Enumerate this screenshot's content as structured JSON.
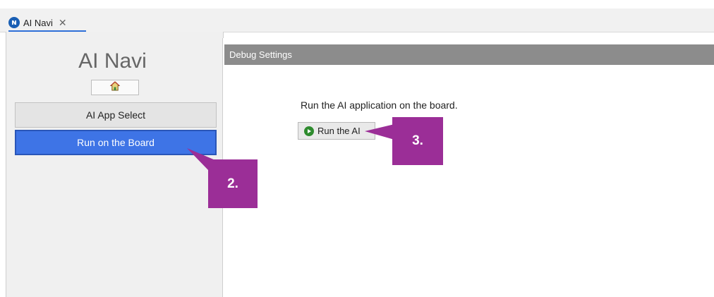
{
  "tab": {
    "label": "AI Navi",
    "close_glyph": "✕",
    "icon": "renesas-logo-icon"
  },
  "sidebar": {
    "title": "AI Navi",
    "home_icon": "home-icon",
    "items": [
      {
        "label": "AI App Select",
        "selected": false
      },
      {
        "label": "Run on the Board",
        "selected": true
      }
    ]
  },
  "main": {
    "section_title": "Debug Settings",
    "description": "Run the AI application on the board.",
    "run_button_label": "Run the AI",
    "run_button_icon": "play-icon"
  },
  "callouts": [
    {
      "label": "2."
    },
    {
      "label": "3."
    }
  ],
  "colors": {
    "accent_blue": "#3e74e6",
    "callout_purple": "#9b2e97",
    "header_gray": "#8c8c8c",
    "play_green": "#2e8b2e"
  }
}
